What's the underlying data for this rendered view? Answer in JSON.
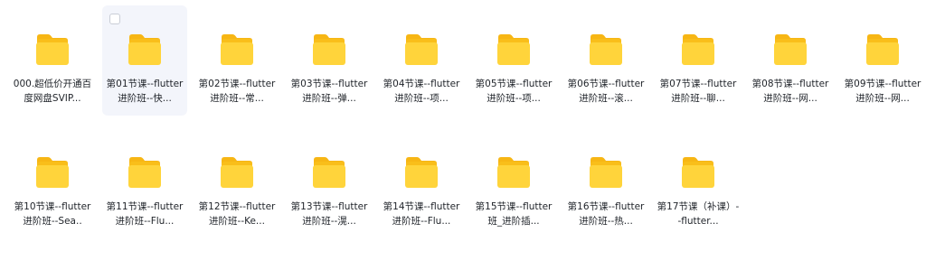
{
  "files": [
    {
      "name": "000.超低价开通百度网盘SVIP...",
      "type": "folder"
    },
    {
      "name": "第01节课--flutter进阶班--快...",
      "type": "folder",
      "state": "hover"
    },
    {
      "name": "第02节课--flutter进阶班--常...",
      "type": "folder"
    },
    {
      "name": "第03节课--flutter进阶班--弹...",
      "type": "folder"
    },
    {
      "name": "第04节课--flutter进阶班--项...",
      "type": "folder"
    },
    {
      "name": "第05节课--flutter进阶班--项...",
      "type": "folder"
    },
    {
      "name": "第06节课--flutter进阶班--滚...",
      "type": "folder"
    },
    {
      "name": "第07节课--flutter进阶班--聊...",
      "type": "folder"
    },
    {
      "name": "第08节课--flutter进阶班--网...",
      "type": "folder"
    },
    {
      "name": "第09节课--flutter进阶班--网...",
      "type": "folder"
    },
    {
      "name": "第10节课--flutter进阶班--Sea..",
      "type": "folder"
    },
    {
      "name": "第11节课--flutter进阶班--Flu...",
      "type": "folder"
    },
    {
      "name": "第12节课--flutter进阶班--Ke...",
      "type": "folder"
    },
    {
      "name": "第13节课--flutter进阶班--滉...",
      "type": "folder"
    },
    {
      "name": "第14节课--flutter进阶班--Flu...",
      "type": "folder"
    },
    {
      "name": "第15节课--flutter班_进阶插...",
      "type": "folder"
    },
    {
      "name": "第16节课--flutter进阶班--热...",
      "type": "folder"
    },
    {
      "name": "第17节课（补课）--flutter...",
      "type": "folder"
    }
  ],
  "colors": {
    "folder_front": "#FFD43B",
    "folder_back": "#F9BE1A",
    "folder_tab": "#F7B614",
    "hover_bg": "#f3f5fb",
    "text": "#1f2329"
  },
  "icons": {
    "folder": "folder-icon",
    "checkbox": "checkbox-icon"
  }
}
